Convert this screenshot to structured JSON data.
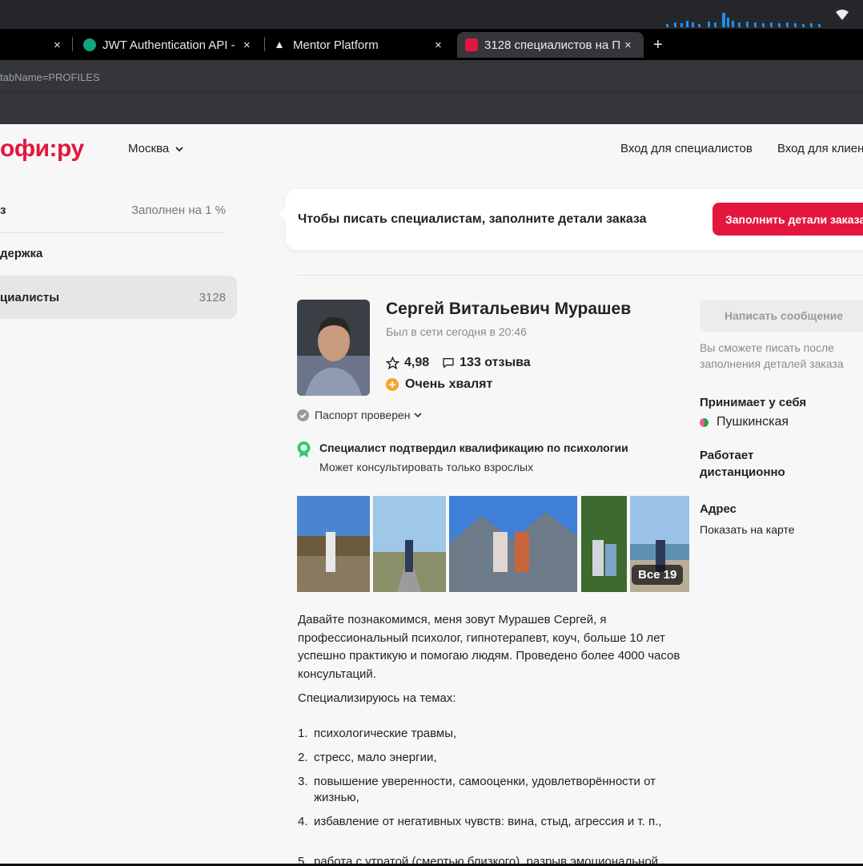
{
  "browser": {
    "tabs": [
      {
        "title": ""
      },
      {
        "title": "JWT Authentication API -"
      },
      {
        "title": "Mentor Platform"
      },
      {
        "title": "3128 специалистов на П"
      }
    ],
    "url": "tabName=PROFILES",
    "new_tab": "+",
    "close_glyph": "×"
  },
  "header": {
    "logo": "офи:ру",
    "city": "Москва",
    "login_specialist": "Вход для специалистов",
    "login_client": "Вход для клиен"
  },
  "sidebar": {
    "items": [
      {
        "label": "з",
        "value": "Заполнен на 1 %"
      },
      {
        "label": "держка",
        "value": ""
      },
      {
        "label": "циалисты",
        "value": "3128"
      }
    ]
  },
  "banner": {
    "text": "Чтобы писать специалистам, заполните детали заказа",
    "button": "Заполнить детали заказа"
  },
  "profile": {
    "name": "Сергей Витальевич Мурашев",
    "last_seen": "Был в сети сегодня в 20:46",
    "rating": "4,98",
    "reviews": "133 отзыва",
    "praise": "Очень хвалят",
    "passport": "Паспорт проверен",
    "qualification_title": "Специалист подтвердил квалификацию по психологии",
    "qualification_sub": "Может консультировать только взрослых",
    "photos_all": "Все 19",
    "about": "Давайте познакомимся, меня зовут Мурашев Сергей, я профессиональный психолог, гипнотерапевт, коуч, больше 10 лет успешно практикую и помогаю людям. Проведено более 4000 часов консультаций.",
    "specializes": "Специализируюсь на темах:",
    "topics": [
      {
        "num": "1.",
        "text": "психологические травмы,"
      },
      {
        "num": "2.",
        "text": "стресс, мало энергии,"
      },
      {
        "num": "3.",
        "text": "повышение уверенности, самооценки, удовлетворённости от жизнью,"
      },
      {
        "num": "4.",
        "text": "избавление от негативных чувств: вина, стыд, агрессия и т. п.,"
      },
      {
        "num": "5.",
        "text": "работа с утратой (смертью близкого), разрыв эмоциональной"
      }
    ]
  },
  "right": {
    "message_button": "Написать сообщение",
    "message_note": "Вы сможете писать после заполнения деталей заказа",
    "receives_title": "Принимает у себя",
    "metro": "Пушкинская",
    "remote": "Работает дистанционно",
    "address_title": "Адрес",
    "address_link": "Показать на карте"
  },
  "colors": {
    "brand": "#e3173e",
    "praise": "#f5a623",
    "verified": "#2ecc71"
  }
}
